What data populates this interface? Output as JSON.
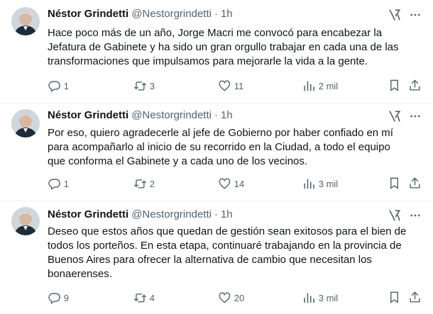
{
  "tweets": [
    {
      "author": {
        "name": "Néstor Grindetti",
        "handle": "@Nestorgrindetti"
      },
      "time": "1h",
      "text": "Hace poco más de un año, Jorge Macri me convocó para encabezar la\nJefatura de Gabinete y ha sido un gran orgullo trabajar en cada una de las\ntransformaciones que impulsamos para mejorarle la vida a la gente.",
      "stats": {
        "replies": "1",
        "reposts": "3",
        "likes": "11",
        "views": "2 mil"
      }
    },
    {
      "author": {
        "name": "Néstor Grindetti",
        "handle": "@Nestorgrindetti"
      },
      "time": "1h",
      "text": "Por eso, quiero agradecerle al jefe de Gobierno por haber confiado en mí\npara acompañarlo al inicio de su recorrido en la Ciudad, a todo el equipo\nque conforma el Gabinete y a cada uno de los vecinos.",
      "stats": {
        "replies": "1",
        "reposts": "2",
        "likes": "14",
        "views": "3 mil"
      }
    },
    {
      "author": {
        "name": "Néstor Grindetti",
        "handle": "@Nestorgrindetti"
      },
      "time": "1h",
      "text": "Deseo que estos años que quedan de gestión sean exitosos para el bien de\ntodos los porteños. En esta etapa, continuaré trabajando en la provincia de\nBuenos Aires para ofrecer la alternativa de cambio que necesitan los\nbonaerenses.",
      "stats": {
        "replies": "9",
        "reposts": "4",
        "likes": "20",
        "views": "3 mil"
      }
    }
  ],
  "icons": {
    "grok": "grok-icon",
    "more": "more-icon",
    "reply": "reply-icon",
    "repost": "repost-icon",
    "like": "like-icon",
    "views": "views-icon",
    "bookmark": "bookmark-icon",
    "share": "share-icon"
  },
  "colors": {
    "text": "#0f1419",
    "secondary": "#536471",
    "divider": "#eff3f4"
  }
}
